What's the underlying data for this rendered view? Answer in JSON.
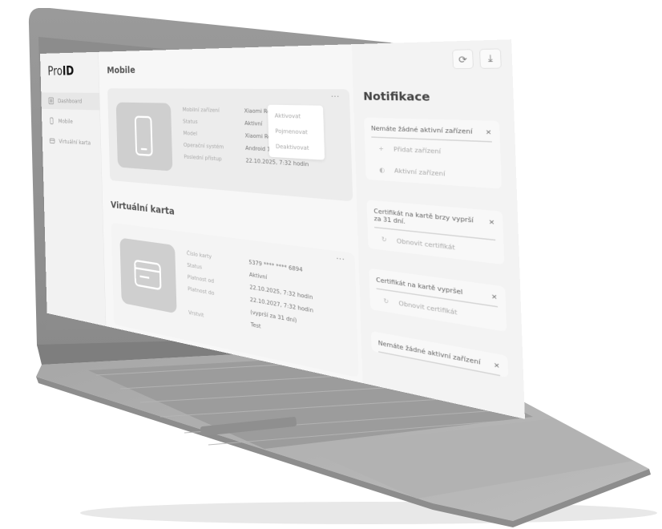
{
  "app": {
    "logo_light": "Pro",
    "logo_bold": "ID"
  },
  "sidebar": {
    "items": [
      {
        "label": "Dashboard",
        "icon": "dashboard-icon"
      },
      {
        "label": "Mobile",
        "icon": "phone-icon"
      },
      {
        "label": "Virtuální karta",
        "icon": "card-icon"
      }
    ]
  },
  "mobile": {
    "title": "Mobile",
    "rows": [
      {
        "k": "Mobilní zařízení",
        "v": "Xiaomi Redmi A3"
      },
      {
        "k": "Status",
        "v": "Aktivní"
      },
      {
        "k": "Model",
        "v": "Xiaomi Redmi A3"
      },
      {
        "k": "Operační systém",
        "v": "Android 13.2"
      },
      {
        "k": "Poslední přístup",
        "v": "22.10.2025, 7:32 hodin"
      }
    ],
    "menu": [
      "Aktivovat",
      "Pojmenovat",
      "Deaktivovat"
    ],
    "more": "···"
  },
  "card": {
    "title": "Virtuální karta",
    "rows": [
      {
        "k": "Číslo karty",
        "v": "5379 **** **** 6894"
      },
      {
        "k": "Status",
        "v": "Aktivní"
      },
      {
        "k": "Platnost od",
        "v": "22.10.2025, 7:32 hodin"
      },
      {
        "k": "Platnost do",
        "v": "22.10.2027, 7:32 hodin"
      },
      {
        "k": "",
        "v": "(vyprší za 31 dní)"
      },
      {
        "k": "Vrstvit",
        "v": "Test"
      }
    ],
    "more": "···"
  },
  "notifications": {
    "title": "Notifikace",
    "items": [
      {
        "title": "Nemáte žádné aktivní zařízení",
        "actions": [
          "Přidat zařízení",
          "Aktivní zařízení"
        ]
      },
      {
        "title": "Certifikát na kartě brzy vyprší za 31 dní.",
        "actions": [
          "Obnovit certifikát"
        ]
      },
      {
        "title": "Certifikát na kartě vypršel",
        "actions": [
          "Obnovit certifikát"
        ]
      },
      {
        "title": "Nemáte žádné aktivní zařízení",
        "actions": []
      }
    ],
    "close": "×"
  },
  "toolbar": {
    "refresh": "⟳",
    "download": "⤓"
  }
}
